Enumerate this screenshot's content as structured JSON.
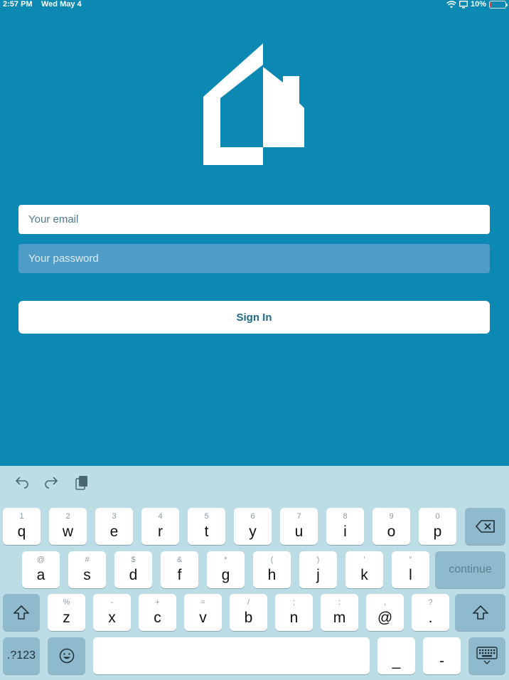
{
  "status_bar": {
    "time": "2:57 PM",
    "date": "Wed May 4",
    "battery": "10%",
    "battery_level": 0.1
  },
  "login": {
    "email_placeholder": "Your email",
    "password_placeholder": "Your password",
    "sign_in_label": "Sign In"
  },
  "keyboard": {
    "toolbar": {
      "undo_icon": "undo-icon",
      "redo_icon": "redo-icon",
      "paste_icon": "paste-icon"
    },
    "row1": [
      {
        "hint": "1",
        "key": "q"
      },
      {
        "hint": "2",
        "key": "w"
      },
      {
        "hint": "3",
        "key": "e"
      },
      {
        "hint": "4",
        "key": "r"
      },
      {
        "hint": "5",
        "key": "t"
      },
      {
        "hint": "6",
        "key": "y"
      },
      {
        "hint": "7",
        "key": "u"
      },
      {
        "hint": "8",
        "key": "i"
      },
      {
        "hint": "9",
        "key": "o"
      },
      {
        "hint": "0",
        "key": "p"
      }
    ],
    "row2": [
      {
        "hint": "@",
        "key": "a"
      },
      {
        "hint": "#",
        "key": "s"
      },
      {
        "hint": "$",
        "key": "d"
      },
      {
        "hint": "&",
        "key": "f"
      },
      {
        "hint": "*",
        "key": "g"
      },
      {
        "hint": "(",
        "key": "h"
      },
      {
        "hint": ")",
        "key": "j"
      },
      {
        "hint": "'",
        "key": "k"
      },
      {
        "hint": "\"",
        "key": "l"
      }
    ],
    "row3": [
      {
        "hint": "%",
        "key": "z"
      },
      {
        "hint": "-",
        "key": "x"
      },
      {
        "hint": "+",
        "key": "c"
      },
      {
        "hint": "=",
        "key": "v"
      },
      {
        "hint": "/",
        "key": "b"
      },
      {
        "hint": ";",
        "key": "n"
      },
      {
        "hint": ":",
        "key": "m"
      },
      {
        "hint": ",",
        "key": "@"
      },
      {
        "hint": "?",
        "key": "."
      }
    ],
    "continue_label": "continue",
    "numbers_label": ".?123",
    "underscore_label": "_",
    "dash_label": "-",
    "shift_icon": "shift-icon",
    "backspace_icon": "backspace-icon",
    "emoji_icon": "emoji-icon",
    "dismiss_keyboard_icon": "keyboard-dismiss-icon"
  },
  "colors": {
    "background": "#0b89b2",
    "keyboard_bg": "#bcdce6",
    "key_dark": "#8fb9cd",
    "button_text": "#1f6a86"
  }
}
